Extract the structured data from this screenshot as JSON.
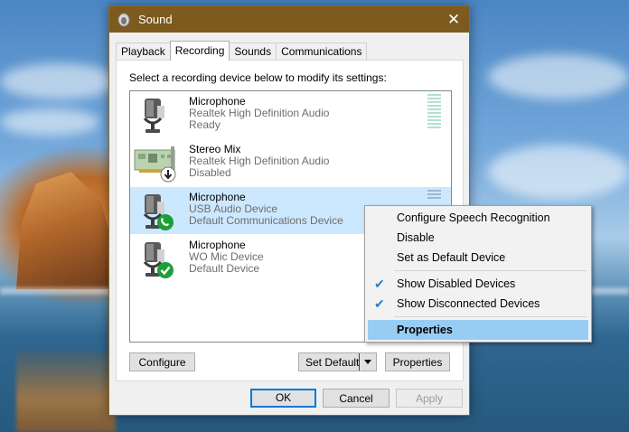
{
  "window": {
    "title": "Sound"
  },
  "tabs": [
    {
      "label": "Playback"
    },
    {
      "label": "Recording"
    },
    {
      "label": "Sounds"
    },
    {
      "label": "Communications"
    }
  ],
  "active_tab": "Recording",
  "instruction": "Select a recording device below to modify its settings:",
  "devices": [
    {
      "name": "Microphone",
      "driver": "Realtek High Definition Audio",
      "status": "Ready",
      "icon": "microphone-icon",
      "badge": "none"
    },
    {
      "name": "Stereo Mix",
      "driver": "Realtek High Definition Audio",
      "status": "Disabled",
      "icon": "sound-card-icon",
      "badge": "down-arrow"
    },
    {
      "name": "Microphone",
      "driver": "USB Audio Device",
      "status": "Default Communications Device",
      "icon": "microphone-icon",
      "badge": "phone",
      "selected": true
    },
    {
      "name": "Microphone",
      "driver": "WO Mic Device",
      "status": "Default Device",
      "icon": "microphone-icon",
      "badge": "check"
    }
  ],
  "buttons": {
    "configure": "Configure",
    "set_default": "Set Default",
    "properties": "Properties",
    "ok": "OK",
    "cancel": "Cancel",
    "apply": "Apply"
  },
  "context_menu": {
    "items": [
      {
        "label": "Configure Speech Recognition",
        "checked": false
      },
      {
        "label": "Disable",
        "checked": false
      },
      {
        "label": "Set as Default Device",
        "checked": false
      },
      {
        "label": "Show Disabled Devices",
        "checked": true
      },
      {
        "label": "Show Disconnected Devices",
        "checked": true
      },
      {
        "label": "Properties",
        "checked": false,
        "highlighted": true
      }
    ]
  },
  "colors": {
    "title_bar": "#7d5a1e",
    "selection": "#cce8ff",
    "menu_highlight": "#99ccf3",
    "badge_green": "#1e9e3a",
    "default_button_border": "#0078d7"
  }
}
